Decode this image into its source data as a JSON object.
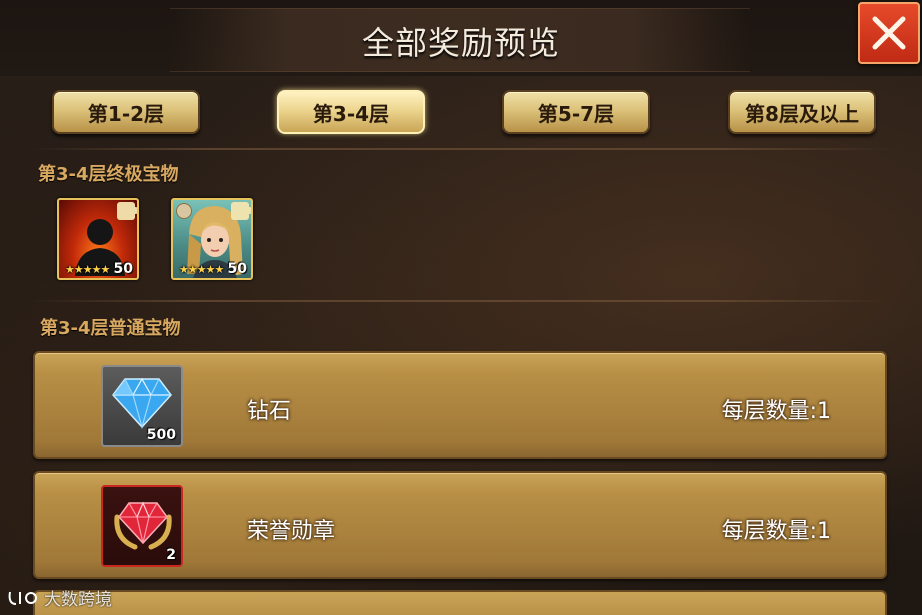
{
  "header": {
    "title": "全部奖励预览"
  },
  "tabs": [
    {
      "label": "第1-2层",
      "active": false
    },
    {
      "label": "第3-4层",
      "active": true
    },
    {
      "label": "第5-7层",
      "active": false
    },
    {
      "label": "第8层及以上",
      "active": false
    }
  ],
  "ultimate": {
    "title": "第3-4层终极宝物",
    "items": [
      {
        "icon": "mystery-hero-portrait",
        "stars": "★★★★★",
        "count": "50"
      },
      {
        "icon": "female-hero-portrait",
        "stars": "★★★★★",
        "count": "50"
      }
    ]
  },
  "normal": {
    "title": "第3-4层普通宝物",
    "items": [
      {
        "icon": "diamond-icon",
        "name": "钻石",
        "count": "500",
        "qty": "每层数量:1"
      },
      {
        "icon": "honor-medal-icon",
        "name": "荣誉勋章",
        "count": "2",
        "qty": "每层数量:1"
      }
    ]
  },
  "watermark": {
    "text": "大数跨境"
  },
  "colors": {
    "tab_gold": "#dcc27a",
    "section_title": "#d8a860",
    "row_gold": "#b88f45",
    "close_red": "#d8381e"
  }
}
